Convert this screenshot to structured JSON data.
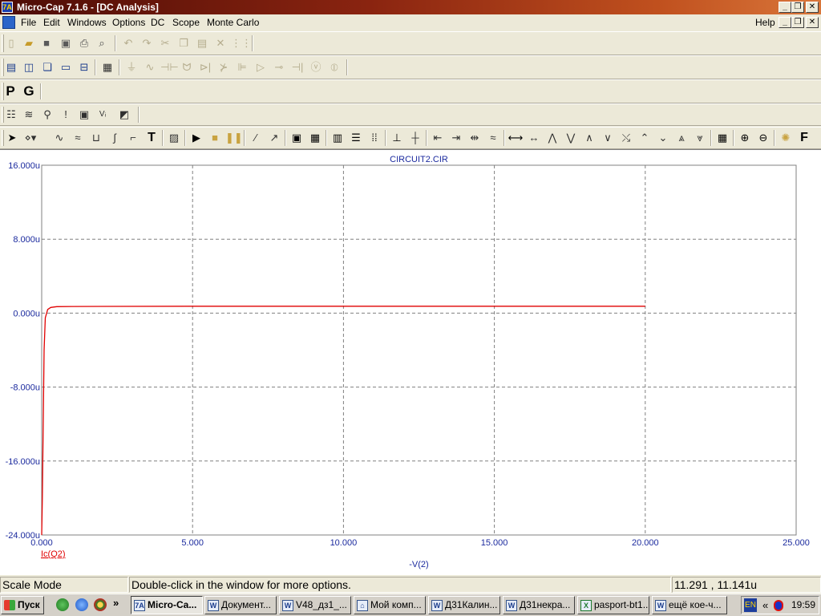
{
  "window": {
    "title": "Micro-Cap 7.1.6 - [DC Analysis]",
    "app_icon_text": "7A",
    "caption_buttons": [
      "_",
      "❐",
      "✕"
    ],
    "mdi_buttons": [
      "_",
      "❐",
      "✕"
    ]
  },
  "menu": {
    "items": [
      "File",
      "Edit",
      "Windows",
      "Options",
      "DC",
      "Scope",
      "Monte Carlo"
    ],
    "help": "Help"
  },
  "toolbars": {
    "probe_buttons": [
      "P",
      "G"
    ],
    "text_tool": "T",
    "font_tool": "F"
  },
  "plot": {
    "title": "CIRCUIT2.CIR",
    "xlabel": "-V(2)",
    "legend": "Ic(Q2)"
  },
  "chart_data": {
    "type": "line",
    "title": "CIRCUIT2.CIR",
    "xlabel": "-V(2)",
    "ylabel": "Ic(Q2)",
    "xlim": [
      0,
      25
    ],
    "ylim": [
      -24,
      16
    ],
    "x_ticks": [
      0,
      5,
      10,
      15,
      20,
      25
    ],
    "x_tick_labels": [
      "0.000",
      "5.000",
      "10.000",
      "15.000",
      "20.000",
      "25.000"
    ],
    "y_ticks": [
      16,
      8,
      0,
      -8,
      -16,
      -24
    ],
    "y_tick_labels": [
      "16.000u",
      "8.000u",
      "0.000u",
      "-8.000u",
      "-16.000u",
      "-24.000u"
    ],
    "grid": true,
    "series": [
      {
        "name": "Ic(Q2)",
        "color": "#e00000",
        "x": [
          0,
          0.02,
          0.05,
          0.08,
          0.12,
          0.2,
          0.3,
          0.5,
          1.0,
          5.0,
          10.0,
          15.0,
          20.0
        ],
        "y": [
          -24,
          -20,
          -12,
          -4,
          -0.5,
          0.4,
          0.62,
          0.7,
          0.72,
          0.75,
          0.75,
          0.75,
          0.75
        ]
      }
    ],
    "colors": {
      "axis_labels": "#1b2a9e",
      "grid": "#808080",
      "title": "#1b2a9e"
    }
  },
  "statusbar": {
    "mode": "Scale Mode",
    "hint": "Double-click in the window for more options.",
    "coords": "11.291 , 11.141u"
  },
  "taskbar": {
    "start_label": "Пуск",
    "tasks": [
      {
        "label": "Micro-Ca...",
        "active": true,
        "icon": "7A"
      },
      {
        "label": "Документ...",
        "active": false,
        "icon": "W"
      },
      {
        "label": "V48_дз1_...",
        "active": false,
        "icon": "W"
      },
      {
        "label": "Мой комп...",
        "active": false,
        "icon": "⌂"
      },
      {
        "label": "Д31Калин...",
        "active": false,
        "icon": "W"
      },
      {
        "label": "Д31некра...",
        "active": false,
        "icon": "W"
      },
      {
        "label": "pasport-bt1...",
        "active": false,
        "icon": "X"
      },
      {
        "label": "ещё кое-ч...",
        "active": false,
        "icon": "W"
      }
    ],
    "tray_lang": "EN",
    "tray_expand": "«",
    "clock": "19:59"
  }
}
